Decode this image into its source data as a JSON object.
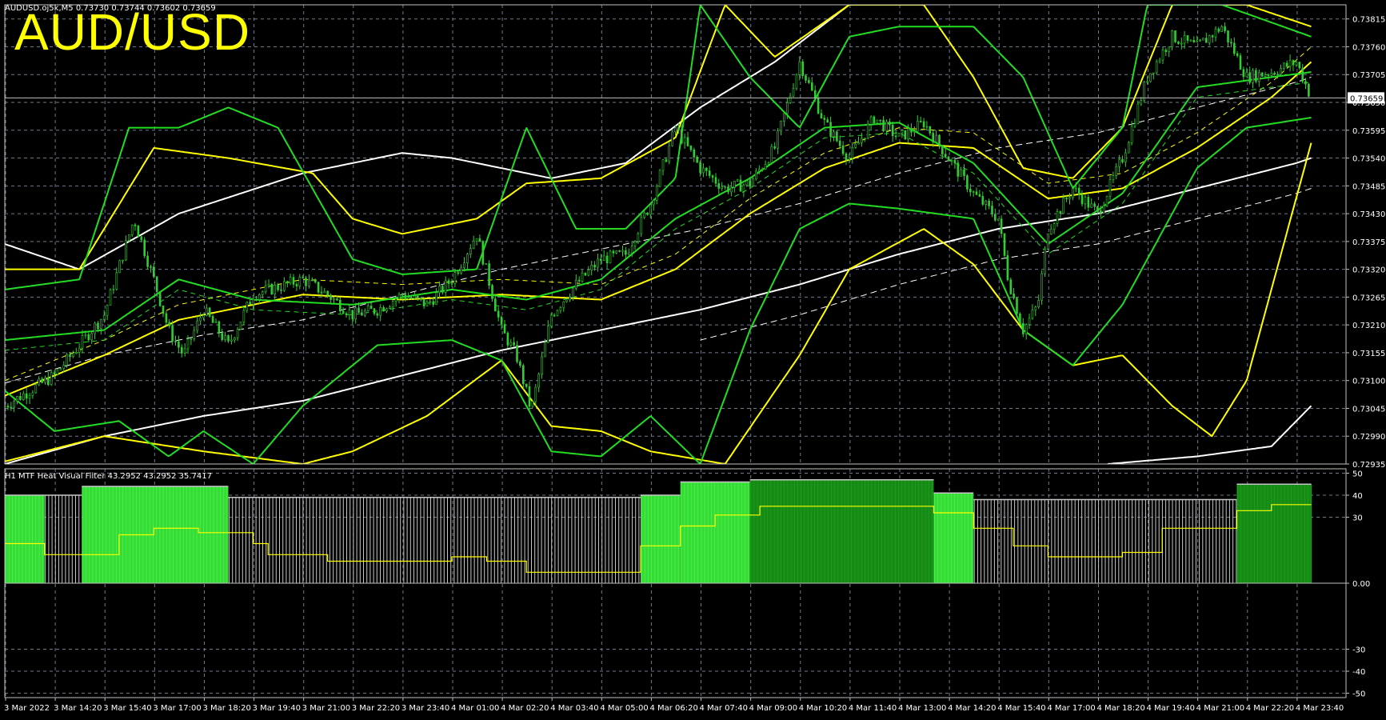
{
  "header": {
    "symbol": "AUDUSD.oj5k,M5",
    "ohlc": "0.73730 0.73744 0.73602 0.73659",
    "overlay_title": "AUD/USD"
  },
  "indicator": {
    "title": "H1 MTF Heat Visual Filter 43.2952 43.2952 35.7417"
  },
  "colors": {
    "background": "#000000",
    "grid": "#6e7a8a",
    "candle": "#32cd32",
    "bands_green": "#22dd22",
    "bands_yellow": "#ffff00",
    "ma_white": "#ffffff",
    "heat_light": "#33dd33",
    "heat_dark": "#158a15",
    "heat_neutral": "#c8c8c8",
    "heat_line": "#ffff00",
    "title_color": "#ffff00"
  },
  "chart_data": [
    {
      "type": "candlestick",
      "instrument": "AUDUSD",
      "timeframe": "M5",
      "current_price": "0.73659",
      "ylim": [
        0.72935,
        0.73843
      ],
      "y_ticks": [
        "0.73815",
        "0.73760",
        "0.73705",
        "0.73650",
        "0.73595",
        "0.73540",
        "0.73485",
        "0.73430",
        "0.73375",
        "0.73320",
        "0.73265",
        "0.73210",
        "0.73155",
        "0.73100",
        "0.73045",
        "0.72990",
        "0.72935"
      ],
      "x_ticks": [
        "3 Mar 2022",
        "3 Mar 14:20",
        "3 Mar 15:40",
        "3 Mar 17:00",
        "3 Mar 18:20",
        "3 Mar 19:40",
        "3 Mar 21:00",
        "3 Mar 22:20",
        "3 Mar 23:40",
        "4 Mar 01:00",
        "4 Mar 02:20",
        "4 Mar 03:40",
        "4 Mar 05:00",
        "4 Mar 06:20",
        "4 Mar 07:40",
        "4 Mar 09:00",
        "4 Mar 10:20",
        "4 Mar 11:40",
        "4 Mar 13:00",
        "4 Mar 14:20",
        "4 Mar 15:40",
        "4 Mar 17:00",
        "4 Mar 18:20",
        "4 Mar 19:40",
        "4 Mar 21:00",
        "4 Mar 22:20",
        "4 Mar 23:40"
      ],
      "close_path": [
        [
          0,
          0.7305
        ],
        [
          1,
          0.7311
        ],
        [
          2,
          0.7323
        ],
        [
          2.6,
          0.7342
        ],
        [
          3,
          0.733
        ],
        [
          3.3,
          0.732
        ],
        [
          3.6,
          0.7315
        ],
        [
          4,
          0.7324
        ],
        [
          4.5,
          0.7317
        ],
        [
          5,
          0.7327
        ],
        [
          6,
          0.733
        ],
        [
          6.5,
          0.7327
        ],
        [
          7,
          0.7323
        ],
        [
          7.5,
          0.7324
        ],
        [
          8,
          0.7327
        ],
        [
          8.5,
          0.7325
        ],
        [
          9,
          0.733
        ],
        [
          9.5,
          0.7339
        ],
        [
          10,
          0.732
        ],
        [
          10.3,
          0.7315
        ],
        [
          10.6,
          0.7304
        ],
        [
          11,
          0.7323
        ],
        [
          11.5,
          0.7329
        ],
        [
          12,
          0.7334
        ],
        [
          12.5,
          0.7335
        ],
        [
          13,
          0.7345
        ],
        [
          13.5,
          0.736
        ],
        [
          14,
          0.7352
        ],
        [
          14.5,
          0.7348
        ],
        [
          15,
          0.7349
        ],
        [
          15.5,
          0.7356
        ],
        [
          16,
          0.7373
        ],
        [
          16.5,
          0.7361
        ],
        [
          17,
          0.7354
        ],
        [
          17.5,
          0.7362
        ],
        [
          18,
          0.7358
        ],
        [
          18.5,
          0.7361
        ],
        [
          19,
          0.7354
        ],
        [
          19.5,
          0.7347
        ],
        [
          20,
          0.7342
        ],
        [
          20.2,
          0.733
        ],
        [
          20.5,
          0.732
        ],
        [
          20.8,
          0.7325
        ],
        [
          21,
          0.734
        ],
        [
          21.5,
          0.7348
        ],
        [
          22,
          0.7343
        ],
        [
          22.5,
          0.7354
        ],
        [
          23,
          0.737
        ],
        [
          23.5,
          0.7378
        ],
        [
          24,
          0.7376
        ],
        [
          24.5,
          0.738
        ],
        [
          25,
          0.737
        ],
        [
          25.5,
          0.7371
        ],
        [
          26,
          0.7373
        ],
        [
          26.3,
          0.73659
        ]
      ],
      "white_ma": [
        [
          0,
          0.72935
        ],
        [
          2,
          0.7299
        ],
        [
          4,
          0.7303
        ],
        [
          6,
          0.7306
        ],
        [
          8,
          0.7311
        ],
        [
          10,
          0.7316
        ],
        [
          12,
          0.732
        ],
        [
          14,
          0.7324
        ],
        [
          16,
          0.7329
        ],
        [
          18,
          0.7335
        ],
        [
          20,
          0.734
        ],
        [
          22,
          0.7343
        ],
        [
          24,
          0.7348
        ],
        [
          26,
          0.7353
        ],
        [
          26.3,
          0.7354
        ]
      ],
      "white_ma_upper": [
        [
          0,
          0.7337
        ],
        [
          1.5,
          0.7332
        ],
        [
          3.5,
          0.7343
        ],
        [
          6,
          0.7351
        ],
        [
          8,
          0.7355
        ],
        [
          9,
          0.7354
        ],
        [
          11,
          0.735
        ],
        [
          12.5,
          0.7353
        ],
        [
          14,
          0.7364
        ],
        [
          15.5,
          0.7373
        ],
        [
          17,
          0.73843
        ],
        [
          18,
          0.739
        ]
      ],
      "white_ma_lower": [
        [
          22.2,
          0.72935
        ],
        [
          24,
          0.7295
        ],
        [
          25.5,
          0.7297
        ],
        [
          26.3,
          0.7305
        ]
      ],
      "yellow_mid": [
        [
          0,
          0.7307
        ],
        [
          2,
          0.7315
        ],
        [
          3.5,
          0.7322
        ],
        [
          6,
          0.7327
        ],
        [
          8,
          0.7326
        ],
        [
          10,
          0.7327
        ],
        [
          12,
          0.7326
        ],
        [
          13.5,
          0.7332
        ],
        [
          15,
          0.7343
        ],
        [
          16.5,
          0.7352
        ],
        [
          18,
          0.7357
        ],
        [
          19.5,
          0.7356
        ],
        [
          21,
          0.7346
        ],
        [
          22.5,
          0.7348
        ],
        [
          24,
          0.7356
        ],
        [
          25.5,
          0.7366
        ],
        [
          26.3,
          0.7373
        ]
      ],
      "yellow_upper": [
        [
          0,
          0.7332
        ],
        [
          1.5,
          0.7332
        ],
        [
          3,
          0.7356
        ],
        [
          4.5,
          0.7354
        ],
        [
          6.2,
          0.7351
        ],
        [
          7,
          0.7342
        ],
        [
          8,
          0.7339
        ],
        [
          9.5,
          0.7342
        ],
        [
          10.5,
          0.7349
        ],
        [
          12,
          0.735
        ],
        [
          13.5,
          0.7358
        ],
        [
          14.5,
          0.73843
        ],
        [
          15.5,
          0.7374
        ],
        [
          17,
          0.73843
        ],
        [
          18.5,
          0.73843
        ],
        [
          19.5,
          0.737
        ],
        [
          20.5,
          0.7352
        ],
        [
          21.5,
          0.735
        ],
        [
          22.5,
          0.736
        ],
        [
          23.5,
          0.73843
        ],
        [
          25,
          0.73843
        ],
        [
          26.3,
          0.738
        ]
      ],
      "yellow_lower": [
        [
          0,
          0.7294
        ],
        [
          2,
          0.7299
        ],
        [
          4,
          0.7296
        ],
        [
          6,
          0.72935
        ],
        [
          7,
          0.7296
        ],
        [
          8.5,
          0.7303
        ],
        [
          10,
          0.7314
        ],
        [
          11,
          0.7301
        ],
        [
          12,
          0.73
        ],
        [
          13,
          0.7296
        ],
        [
          14.5,
          0.72935
        ],
        [
          16,
          0.7315
        ],
        [
          17,
          0.7332
        ],
        [
          18.5,
          0.734
        ],
        [
          19.5,
          0.7333
        ],
        [
          20.5,
          0.732
        ],
        [
          21.5,
          0.7313
        ],
        [
          22.5,
          0.7315
        ],
        [
          23.5,
          0.7305
        ],
        [
          24.3,
          0.7299
        ],
        [
          25,
          0.731
        ],
        [
          26.3,
          0.7357
        ]
      ],
      "green_upper": [
        [
          0,
          0.7328
        ],
        [
          1.5,
          0.733
        ],
        [
          2.5,
          0.736
        ],
        [
          3.5,
          0.736
        ],
        [
          4.5,
          0.7364
        ],
        [
          5.5,
          0.736
        ],
        [
          7,
          0.7334
        ],
        [
          8,
          0.7331
        ],
        [
          9.5,
          0.7332
        ],
        [
          10.5,
          0.736
        ],
        [
          11.5,
          0.734
        ],
        [
          12.5,
          0.734
        ],
        [
          13.5,
          0.735
        ],
        [
          14,
          0.73843
        ],
        [
          15,
          0.737
        ],
        [
          16,
          0.736
        ],
        [
          17,
          0.7378
        ],
        [
          18,
          0.738
        ],
        [
          19.5,
          0.738
        ],
        [
          20.5,
          0.737
        ],
        [
          21.5,
          0.7348
        ],
        [
          22.5,
          0.736
        ],
        [
          23,
          0.73843
        ],
        [
          24.5,
          0.73843
        ],
        [
          26.3,
          0.7378
        ]
      ],
      "green_lower": [
        [
          0,
          0.7308
        ],
        [
          1,
          0.73
        ],
        [
          2.3,
          0.7302
        ],
        [
          3.3,
          0.7295
        ],
        [
          4,
          0.73
        ],
        [
          5,
          0.72935
        ],
        [
          6,
          0.7305
        ],
        [
          7.5,
          0.7317
        ],
        [
          9,
          0.7318
        ],
        [
          10,
          0.7314
        ],
        [
          11,
          0.7296
        ],
        [
          12,
          0.7295
        ],
        [
          13,
          0.7303
        ],
        [
          14,
          0.72935
        ],
        [
          15,
          0.732
        ],
        [
          16,
          0.734
        ],
        [
          17,
          0.7345
        ],
        [
          18,
          0.7344
        ],
        [
          19.5,
          0.7342
        ],
        [
          20.5,
          0.732
        ],
        [
          21.5,
          0.7313
        ],
        [
          22.5,
          0.7325
        ],
        [
          24,
          0.7352
        ],
        [
          25,
          0.736
        ],
        [
          26.3,
          0.7362
        ]
      ],
      "green_mid": [
        [
          0,
          0.7318
        ],
        [
          2,
          0.732
        ],
        [
          3.5,
          0.733
        ],
        [
          5,
          0.7326
        ],
        [
          7,
          0.7325
        ],
        [
          9,
          0.7328
        ],
        [
          10.5,
          0.7326
        ],
        [
          12,
          0.733
        ],
        [
          13.5,
          0.7342
        ],
        [
          15,
          0.735
        ],
        [
          16.5,
          0.736
        ],
        [
          18,
          0.7361
        ],
        [
          19.5,
          0.7353
        ],
        [
          21,
          0.7337
        ],
        [
          22.5,
          0.7347
        ],
        [
          24,
          0.7368
        ],
        [
          25.5,
          0.737
        ],
        [
          26.3,
          0.7371
        ]
      ]
    },
    {
      "type": "bar",
      "name_printed": "H1 MTF Heat Visual Filter",
      "ylim": [
        -52,
        52
      ],
      "y_ticks": [
        "50",
        "40",
        "30",
        "0.00",
        "-30",
        "-40",
        "-50"
      ],
      "segments": [
        {
          "x0": 0,
          "x1": 0.8,
          "value": 40,
          "heat": "light"
        },
        {
          "x0": 0.8,
          "x1": 1.55,
          "value": 40,
          "heat": "neutral"
        },
        {
          "x0": 1.55,
          "x1": 4.5,
          "value": 44,
          "heat": "light"
        },
        {
          "x0": 4.5,
          "x1": 12.8,
          "value": 39,
          "heat": "neutral"
        },
        {
          "x0": 12.8,
          "x1": 13.6,
          "value": 40,
          "heat": "light"
        },
        {
          "x0": 13.6,
          "x1": 15,
          "value": 46,
          "heat": "light"
        },
        {
          "x0": 15,
          "x1": 18.7,
          "value": 47,
          "heat": "dark"
        },
        {
          "x0": 18.7,
          "x1": 19.5,
          "value": 41,
          "heat": "light"
        },
        {
          "x0": 19.5,
          "x1": 24.8,
          "value": 38,
          "heat": "neutral"
        },
        {
          "x0": 24.8,
          "x1": 26.3,
          "value": 45,
          "heat": "dark"
        }
      ],
      "signal_line": [
        [
          0,
          18
        ],
        [
          0.8,
          18
        ],
        [
          0.8,
          13
        ],
        [
          2.3,
          13
        ],
        [
          2.3,
          22
        ],
        [
          3,
          22
        ],
        [
          3,
          25
        ],
        [
          3.9,
          25
        ],
        [
          3.9,
          23
        ],
        [
          5,
          23
        ],
        [
          5,
          18
        ],
        [
          5.3,
          18
        ],
        [
          5.3,
          13
        ],
        [
          6.5,
          13
        ],
        [
          6.5,
          10
        ],
        [
          9,
          10
        ],
        [
          9,
          12
        ],
        [
          9.7,
          12
        ],
        [
          9.7,
          10
        ],
        [
          10.5,
          10
        ],
        [
          10.5,
          5
        ],
        [
          12.8,
          5
        ],
        [
          12.8,
          17
        ],
        [
          13.6,
          17
        ],
        [
          13.6,
          26
        ],
        [
          14.3,
          26
        ],
        [
          14.3,
          31
        ],
        [
          15.2,
          31
        ],
        [
          15.2,
          35
        ],
        [
          18.7,
          35
        ],
        [
          18.7,
          32
        ],
        [
          19.5,
          32
        ],
        [
          19.5,
          25
        ],
        [
          20.3,
          25
        ],
        [
          20.3,
          17
        ],
        [
          21,
          17
        ],
        [
          21,
          12
        ],
        [
          22.5,
          12
        ],
        [
          22.5,
          14
        ],
        [
          23.3,
          14
        ],
        [
          23.3,
          25
        ],
        [
          24.8,
          25
        ],
        [
          24.8,
          33
        ],
        [
          25.5,
          33
        ],
        [
          25.5,
          35.7
        ],
        [
          26.3,
          35.7
        ]
      ]
    }
  ]
}
